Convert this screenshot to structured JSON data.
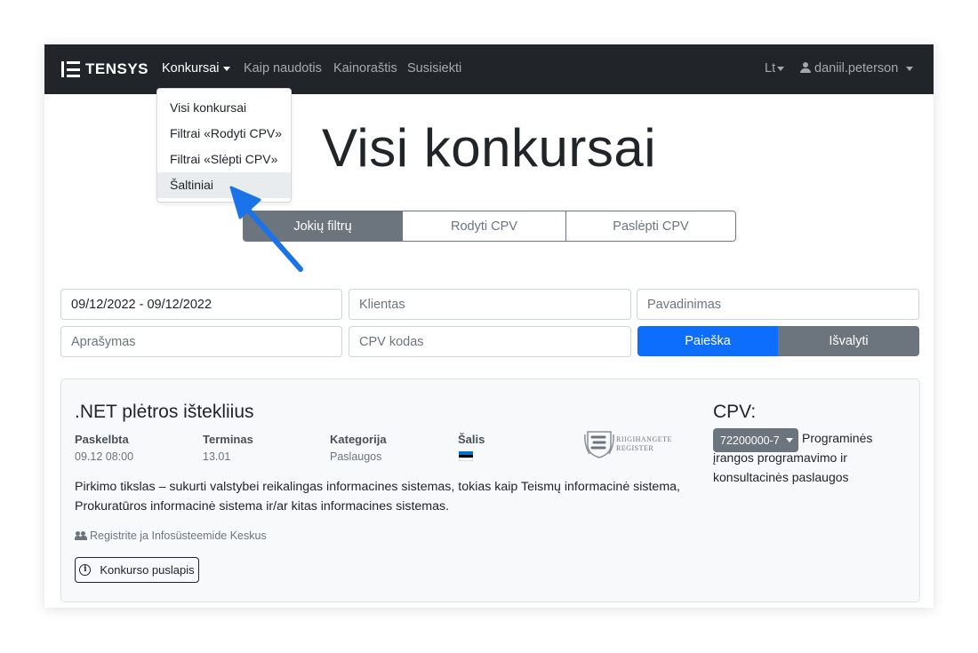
{
  "navbar": {
    "brand": "TENSYS",
    "links": [
      {
        "label": "Konkursai"
      },
      {
        "label": "Kaip naudotis"
      },
      {
        "label": "Kainoraštis"
      },
      {
        "label": "Susisiekti"
      }
    ],
    "language": "Lt",
    "username": "daniil.peterson"
  },
  "dropdown": {
    "items": [
      {
        "label": "Visi konkursai"
      },
      {
        "label": "Filtrai «Rodyti CPV»"
      },
      {
        "label": "Filtrai «Slėpti CPV»"
      },
      {
        "label": "Šaltiniai"
      }
    ]
  },
  "page": {
    "title": "Visi konkursai"
  },
  "filters": {
    "options": [
      "Jokių filtrų",
      "Rodyti CPV",
      "Paslėpti CPV"
    ],
    "selected": "Jokių filtrų"
  },
  "search": {
    "date_value": "09/12/2022 - 09/12/2022",
    "client_placeholder": "Klientas",
    "name_placeholder": "Pavadinimas",
    "description_placeholder": "Aprašymas",
    "cpv_placeholder": "CPV kodas",
    "search_label": "Paieška",
    "clear_label": "Išvalyti"
  },
  "tender": {
    "title": ".NET plėtros ištekliius",
    "published_label": "Paskelbta",
    "published_value": "09.12 08:00",
    "deadline_label": "Terminas",
    "deadline_value": "13.01",
    "category_label": "Kategorija",
    "category_value": "Paslaugos",
    "country_label": "Šalis",
    "country_flag": "Estonia",
    "source_logo_line1": "Riigihangete",
    "source_logo_line2": "Register",
    "description": "Pirkimo tikslas – sukurti valstybei reikalingas informacines sistemas, tokias kaip Teismų informacinė sistema, Prokuratūros informacinė sistema ir/ar kitas informacines sistemas.",
    "organization": "Registrite ja Infosüsteemide Keskus",
    "page_button": "Konkurso puslapis",
    "cpv_title": "CPV:",
    "cpv_code": "72200000-7",
    "cpv_description": "Programinės įrangos programavimo ir konsultacinės paslaugos"
  },
  "colors": {
    "navbar_bg": "#212529",
    "primary": "#0d6efd",
    "secondary": "#6c757d",
    "arrow": "#1a73e8"
  }
}
